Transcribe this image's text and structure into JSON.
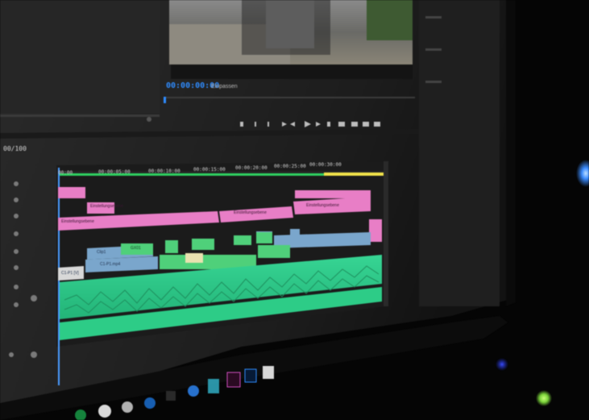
{
  "program_monitor": {
    "timecode": "00:00:00:00",
    "fit_label": "Einpassen"
  },
  "timeline": {
    "sequence_counter": "00/100",
    "ruler": [
      "00:00",
      "00:00:05:00",
      "00:00:10:00",
      "00:00:15:00",
      "00:00:20:00",
      "00:00:25:00",
      "00:00:30:00"
    ],
    "clip_labels": {
      "pink_top_a": "Einstellungsebene",
      "pink_long_a": "Einstellungsebene",
      "pink_long_b": "Einstellungsebene",
      "pink_right": "Einstellungsebene",
      "blue_a": "Clip1",
      "blue_b": "C1-P1.mp4",
      "blue_c": "C1-P1 [V]",
      "green_a": "GX01"
    }
  },
  "colors": {
    "adjustment_pink": "#e87ec6",
    "video_blue": "#7aa6cc",
    "audio_green": "#2fcf8e",
    "timecode_blue": "#2f8cff",
    "playhead": "#4a9cff"
  },
  "taskbar_icons": [
    "premiere-pro-icon",
    "photoshop-icon",
    "after-effects-icon",
    "steam-icon",
    "whatsapp-icon",
    "spotify-icon"
  ]
}
